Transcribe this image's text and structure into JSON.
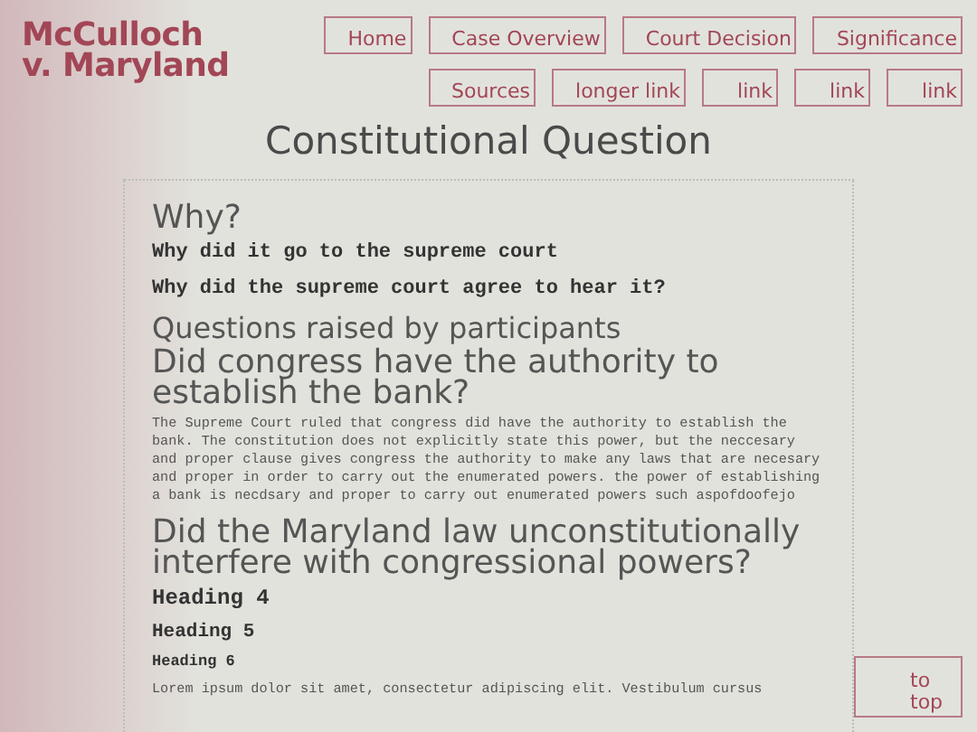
{
  "site_title": "McCulloch v. Maryland",
  "nav": [
    [
      "Home",
      "Case Overview",
      "Court Decision",
      "Significance"
    ],
    [
      "Sources",
      "longer link",
      "link",
      "link",
      "link"
    ]
  ],
  "page_title": "Constitutional Question",
  "content": [
    {
      "kind": "h1",
      "text": "Why?"
    },
    {
      "kind": "h3",
      "text": "Why did it go to the supreme court"
    },
    {
      "kind": "h3",
      "text": "Why did the supreme court agree to hear it?"
    },
    {
      "kind": "h2",
      "text": "Questions raised by participants"
    },
    {
      "kind": "h1",
      "text": "Did congress have the authority to establish the bank?"
    },
    {
      "kind": "p",
      "text": "The Supreme Court ruled that congress did have the authority to establish the bank. The constitution does not explicitly state this power, but the neccesary and proper clause gives congress the authority to make any laws that are necesary and proper in order to carry out the enumerated powers. the power of establishing a bank is necdsary and proper to carry out enumerated powers such aspofdoofejo"
    },
    {
      "kind": "h1",
      "text": "Did the Maryland law unconstitutionally interfere with congressional powers?"
    },
    {
      "kind": "h4",
      "text": "Heading 4"
    },
    {
      "kind": "h5",
      "text": "Heading 5"
    },
    {
      "kind": "h6",
      "text": "Heading 6"
    },
    {
      "kind": "p",
      "text": "Lorem ipsum dolor sit amet, consectetur adipiscing elit. Vestibulum cursus"
    }
  ],
  "to_top": "to top"
}
